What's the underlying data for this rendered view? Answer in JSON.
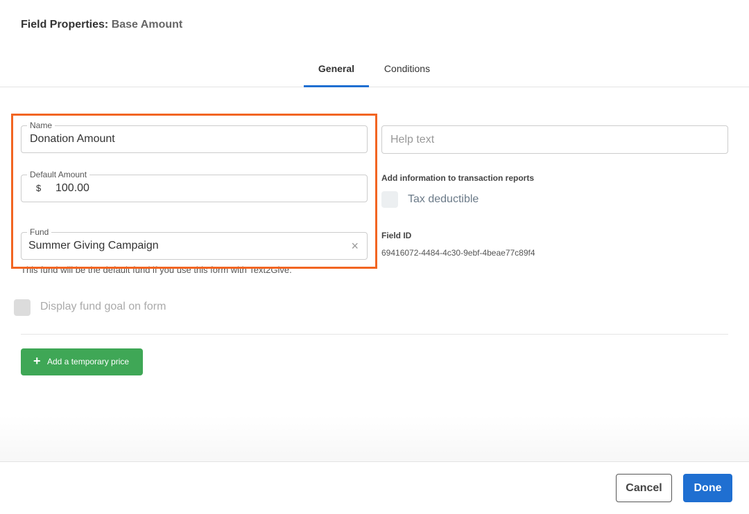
{
  "header": {
    "title_prefix": "Field Properties:",
    "title_field": "Base Amount"
  },
  "tabs": [
    {
      "label": "General",
      "active": true
    },
    {
      "label": "Conditions",
      "active": false
    }
  ],
  "form": {
    "name": {
      "label": "Name",
      "value": "Donation Amount"
    },
    "default_amount": {
      "label": "Default Amount",
      "currency": "$",
      "value": "100.00"
    },
    "fund": {
      "label": "Fund",
      "value": "Summer Giving Campaign",
      "clear_icon": "×"
    },
    "fund_hint": "This fund will be the default fund if you use this form with Text2Give.",
    "display_goal": {
      "label": "Display fund goal on form",
      "checked": false
    },
    "temp_price_button": {
      "icon": "+",
      "label": "Add a temporary price"
    }
  },
  "side": {
    "help_text": {
      "placeholder": "Help text"
    },
    "report_label": "Add information to transaction reports",
    "tax_deductible": {
      "label": "Tax deductible",
      "checked": false
    },
    "field_id": {
      "label": "Field ID",
      "value": "69416072-4484-4c30-9ebf-4beae77c89f4"
    }
  },
  "footer": {
    "cancel_label": "Cancel",
    "done_label": "Done"
  },
  "colors": {
    "highlight": "#f26522",
    "primary": "#1f6fd1",
    "success": "#3fa756"
  }
}
